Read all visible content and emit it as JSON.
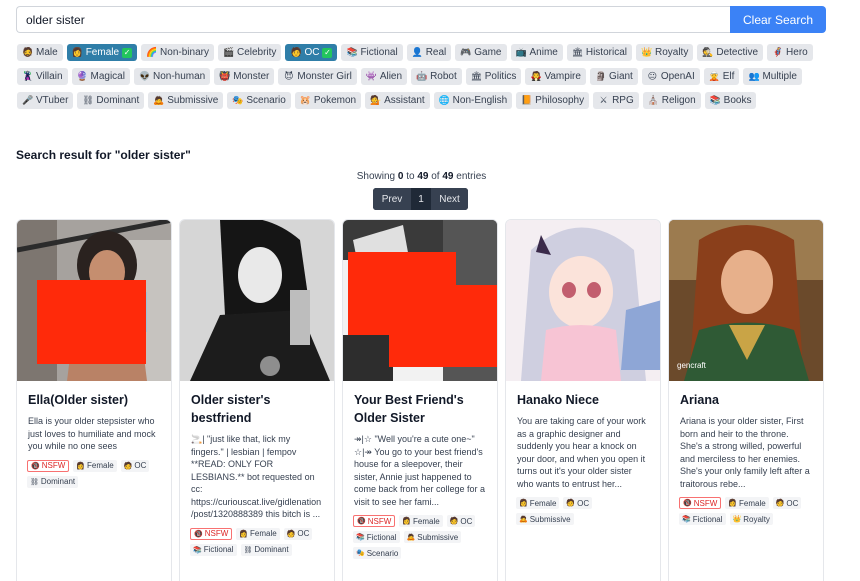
{
  "search": {
    "value": "older sister",
    "clear_label": "Clear Search"
  },
  "tags": [
    {
      "label": "Male",
      "icon": "🧔",
      "icon_name": "male-icon",
      "active": false
    },
    {
      "label": "Female",
      "icon": "👩",
      "icon_name": "female-icon",
      "active": true
    },
    {
      "label": "Non-binary",
      "icon": "🌈",
      "icon_name": "rainbow-icon",
      "active": false
    },
    {
      "label": "Celebrity",
      "icon": "🎬",
      "icon_name": "celebrity-icon",
      "active": false
    },
    {
      "label": "OC",
      "icon": "🧑",
      "icon_name": "oc-icon",
      "active": true
    },
    {
      "label": "Fictional",
      "icon": "📚",
      "icon_name": "books-icon",
      "active": false
    },
    {
      "label": "Real",
      "icon": "👤",
      "icon_name": "person-icon",
      "active": false
    },
    {
      "label": "Game",
      "icon": "🎮",
      "icon_name": "gamepad-icon",
      "active": false
    },
    {
      "label": "Anime",
      "icon": "📺",
      "icon_name": "tv-icon",
      "active": false
    },
    {
      "label": "Historical",
      "icon": "🏛",
      "icon_name": "historical-icon",
      "active": false
    },
    {
      "label": "Royalty",
      "icon": "👑",
      "icon_name": "crown-icon",
      "active": false
    },
    {
      "label": "Detective",
      "icon": "🕵",
      "icon_name": "detective-icon",
      "active": false
    },
    {
      "label": "Hero",
      "icon": "🦸",
      "icon_name": "hero-icon",
      "active": false
    },
    {
      "label": "Villain",
      "icon": "🦹",
      "icon_name": "villain-icon",
      "active": false
    },
    {
      "label": "Magical",
      "icon": "🔮",
      "icon_name": "crystal-ball-icon",
      "active": false
    },
    {
      "label": "Non-human",
      "icon": "👽",
      "icon_name": "nonhuman-icon",
      "active": false
    },
    {
      "label": "Monster",
      "icon": "👹",
      "icon_name": "monster-icon",
      "active": false
    },
    {
      "label": "Monster Girl",
      "icon": "😈",
      "icon_name": "monster-girl-icon",
      "active": false
    },
    {
      "label": "Alien",
      "icon": "👾",
      "icon_name": "alien-icon",
      "active": false
    },
    {
      "label": "Robot",
      "icon": "🤖",
      "icon_name": "robot-icon",
      "active": false
    },
    {
      "label": "Politics",
      "icon": "🏛",
      "icon_name": "politics-icon",
      "active": false
    },
    {
      "label": "Vampire",
      "icon": "🧛",
      "icon_name": "vampire-icon",
      "active": false
    },
    {
      "label": "Giant",
      "icon": "🗿",
      "icon_name": "giant-icon",
      "active": false
    },
    {
      "label": "OpenAI",
      "icon": "😐",
      "icon_name": "openai-icon",
      "active": false
    },
    {
      "label": "Elf",
      "icon": "🧝",
      "icon_name": "elf-icon",
      "active": false
    },
    {
      "label": "Multiple",
      "icon": "👥",
      "icon_name": "people-icon",
      "active": false
    },
    {
      "label": "VTuber",
      "icon": "🎤",
      "icon_name": "vtuber-icon",
      "active": false
    },
    {
      "label": "Dominant",
      "icon": "⛓",
      "icon_name": "chain-icon",
      "active": false
    },
    {
      "label": "Submissive",
      "icon": "🙇",
      "icon_name": "submissive-icon",
      "active": false
    },
    {
      "label": "Scenario",
      "icon": "🎭",
      "icon_name": "theater-icon",
      "active": false
    },
    {
      "label": "Pokemon",
      "icon": "🐹",
      "icon_name": "pokemon-icon",
      "active": false
    },
    {
      "label": "Assistant",
      "icon": "💁",
      "icon_name": "assistant-icon",
      "active": false
    },
    {
      "label": "Non-English",
      "icon": "🌐",
      "icon_name": "globe-icon",
      "active": false
    },
    {
      "label": "Philosophy",
      "icon": "📙",
      "icon_name": "book-icon",
      "active": false
    },
    {
      "label": "RPG",
      "icon": "⚔",
      "icon_name": "swords-icon",
      "active": false
    },
    {
      "label": "Religon",
      "icon": "⛪",
      "icon_name": "church-icon",
      "active": false
    },
    {
      "label": "Books",
      "icon": "📚",
      "icon_name": "books-icon",
      "active": false
    }
  ],
  "results": {
    "heading": "Search result for \"older sister\"",
    "showing_prefix": "Showing",
    "from": "0",
    "to_word": "to",
    "to": "49",
    "of_word": "of",
    "total": "49",
    "suffix": "entries"
  },
  "pager": {
    "prev": "Prev",
    "page": "1",
    "next": "Next"
  },
  "cards": [
    {
      "title": "Ella(Older sister)",
      "description": "Ella is your older stepsister who just loves to humiliate and mock you while no one sees",
      "badges": [
        {
          "label": "NSFW",
          "icon": "🔞",
          "icon_name": "nsfw-icon",
          "nsfw": true
        },
        {
          "label": "Female",
          "icon": "👩",
          "icon_name": "female-icon"
        },
        {
          "label": "OC",
          "icon": "🧑",
          "icon_name": "oc-icon"
        },
        {
          "label": "Dominant",
          "icon": "⛓",
          "icon_name": "chain-icon"
        }
      ]
    },
    {
      "title": "Older sister's bestfriend",
      "description": "🚬| \"just like that, lick my fingers.\" | lesbian | fempov **READ: ONLY FOR LESBIANS.** bot requested on cc: https://curiouscat.live/gidlenation/post/1320888389 this bitch is ...",
      "badges": [
        {
          "label": "NSFW",
          "icon": "🔞",
          "icon_name": "nsfw-icon",
          "nsfw": true
        },
        {
          "label": "Female",
          "icon": "👩",
          "icon_name": "female-icon"
        },
        {
          "label": "OC",
          "icon": "🧑",
          "icon_name": "oc-icon"
        },
        {
          "label": "Fictional",
          "icon": "📚",
          "icon_name": "books-icon"
        },
        {
          "label": "Dominant",
          "icon": "⛓",
          "icon_name": "chain-icon"
        }
      ]
    },
    {
      "title": "Your Best Friend's Older Sister",
      "description": "↠|☆ \"Well you're a cute one~\" ☆|↠ You go to your best friend's house for a sleepover, their sister, Annie just happened to come back from her college for a visit to see her fami...",
      "badges": [
        {
          "label": "NSFW",
          "icon": "🔞",
          "icon_name": "nsfw-icon",
          "nsfw": true
        },
        {
          "label": "Female",
          "icon": "👩",
          "icon_name": "female-icon"
        },
        {
          "label": "OC",
          "icon": "🧑",
          "icon_name": "oc-icon"
        },
        {
          "label": "Fictional",
          "icon": "📚",
          "icon_name": "books-icon"
        },
        {
          "label": "Submissive",
          "icon": "🙇",
          "icon_name": "submissive-icon"
        },
        {
          "label": "Scenario",
          "icon": "🎭",
          "icon_name": "theater-icon"
        }
      ]
    },
    {
      "title": "Hanako Niece",
      "description": "You are taking care of your work as a graphic designer and suddenly you hear a knock on your door, and when you open it turns out it's your older sister who wants to entrust her...",
      "badges": [
        {
          "label": "Female",
          "icon": "👩",
          "icon_name": "female-icon"
        },
        {
          "label": "OC",
          "icon": "🧑",
          "icon_name": "oc-icon"
        },
        {
          "label": "Submissive",
          "icon": "🙇",
          "icon_name": "submissive-icon"
        }
      ]
    },
    {
      "title": "Ariana",
      "description": "Ariana is your older sister, First born and heir to the throne. She's a strong willed, powerful and merciless to her enemies. She's your only family left after a traitorous rebe...",
      "watermark": "gencraft",
      "badges": [
        {
          "label": "NSFW",
          "icon": "🔞",
          "icon_name": "nsfw-icon",
          "nsfw": true
        },
        {
          "label": "Female",
          "icon": "👩",
          "icon_name": "female-icon"
        },
        {
          "label": "OC",
          "icon": "🧑",
          "icon_name": "oc-icon"
        },
        {
          "label": "Fictional",
          "icon": "📚",
          "icon_name": "books-icon"
        },
        {
          "label": "Royalty",
          "icon": "👑",
          "icon_name": "crown-icon"
        }
      ]
    }
  ],
  "colors": {
    "accent": "#3b82f6",
    "active_tag": "#2f7ea8",
    "redaction": "#ff2a0a",
    "nsfw": "#dc2626"
  }
}
